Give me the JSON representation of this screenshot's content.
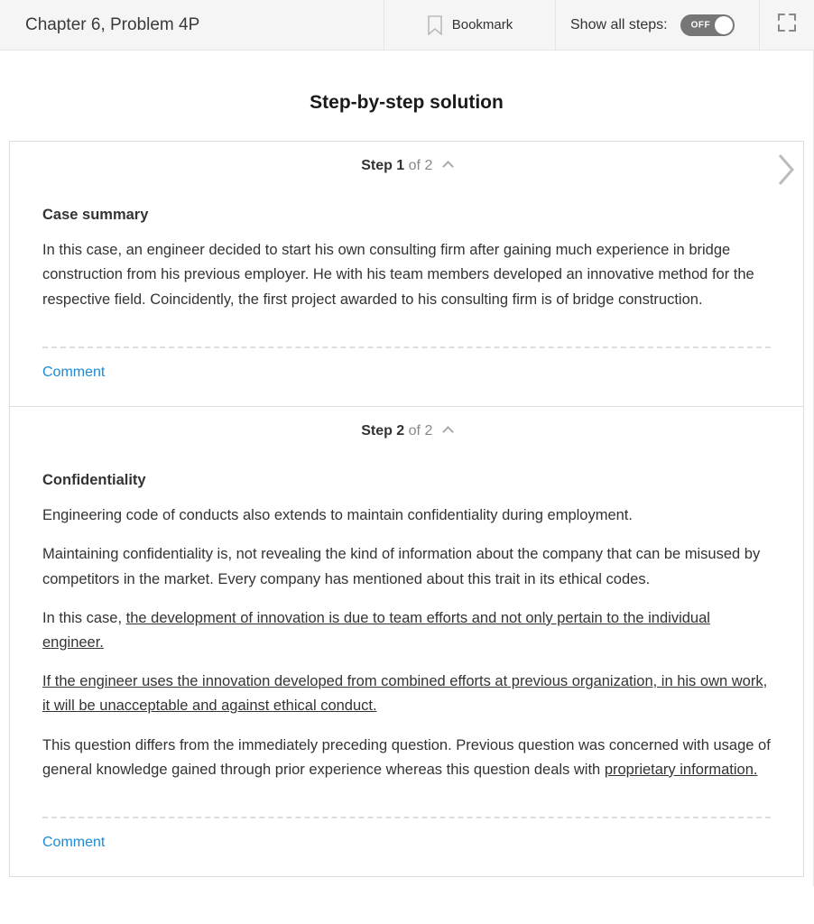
{
  "header": {
    "title": "Chapter 6, Problem 4P",
    "bookmark_label": "Bookmark",
    "steps_label": "Show all steps:",
    "toggle_state": "OFF"
  },
  "solution": {
    "title": "Step-by-step solution"
  },
  "steps": [
    {
      "label_bold": "Step 1",
      "label_muted": " of 2",
      "heading": "Case summary",
      "paragraphs": [
        "In this case, an engineer decided to start his own consulting firm after gaining much experience in bridge construction from his previous employer. He with his team members developed an innovative method for the respective field. Coincidently, the first project awarded to his consulting firm is of bridge construction."
      ],
      "comment_label": "Comment"
    },
    {
      "label_bold": "Step 2",
      "label_muted": " of 2",
      "heading": "Confidentiality",
      "p1": "Engineering code of conducts also extends to maintain confidentiality during employment.",
      "p2": "Maintaining confidentiality is, not revealing the kind of information about the company that can be misused by competitors in the market. Every company has mentioned about this trait in its ethical codes.",
      "p3a": "In this case, ",
      "p3u": "the development of innovation is due to team efforts and not only pertain to the individual engineer.",
      "p4u": "If the engineer uses the innovation developed from combined efforts at previous organization, in his own work, it will be unacceptable and against ethical conduct.",
      "p5a": "This question differs from the immediately preceding question. Previous question was concerned with usage of general knowledge gained through prior experience whereas this question deals with ",
      "p5u": "proprietary information.",
      "comment_label": "Comment"
    }
  ]
}
